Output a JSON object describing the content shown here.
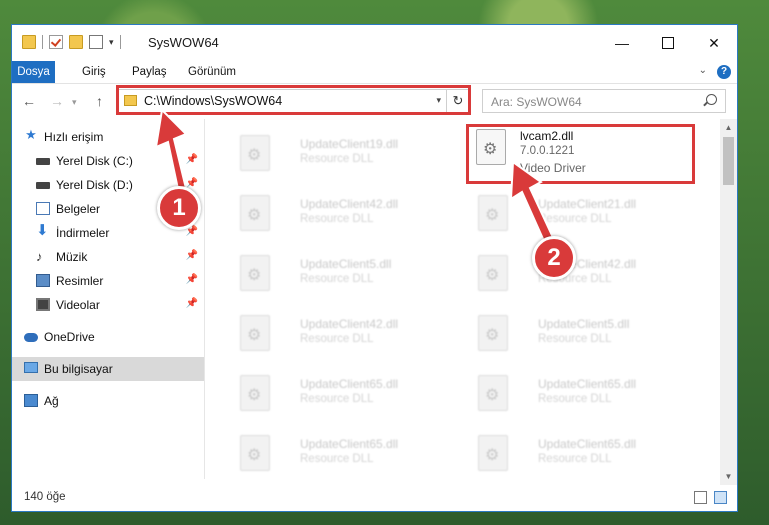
{
  "window": {
    "title": "SysWOW64",
    "controls": {
      "minimize": "—",
      "maximize": "",
      "close": "✕"
    }
  },
  "ribbon": {
    "tabs": [
      "Dosya",
      "Giriş",
      "Paylaş",
      "Görünüm"
    ],
    "help": "?"
  },
  "nav": {
    "back": "←",
    "forward": "→",
    "up": "↑",
    "address": "C:\\Windows\\SysWOW64",
    "refresh": "↻",
    "search_placeholder": "Ara: SysWOW64"
  },
  "sidebar": {
    "items": [
      {
        "label": "Hızlı erişim",
        "icon": "star-icon",
        "pinned": false
      },
      {
        "label": "Yerel Disk (C:)",
        "icon": "drive-icon",
        "pinned": true
      },
      {
        "label": "Yerel Disk (D:)",
        "icon": "drive-icon",
        "pinned": true
      },
      {
        "label": "Belgeler",
        "icon": "documents-icon",
        "pinned": true
      },
      {
        "label": "İndirmeler",
        "icon": "downloads-icon",
        "pinned": true
      },
      {
        "label": "Müzik",
        "icon": "music-icon",
        "pinned": true
      },
      {
        "label": "Resimler",
        "icon": "pictures-icon",
        "pinned": true
      },
      {
        "label": "Videolar",
        "icon": "videos-icon",
        "pinned": true
      },
      {
        "label": "OneDrive",
        "icon": "onedrive-icon",
        "pinned": false
      },
      {
        "label": "Bu bilgisayar",
        "icon": "computer-icon",
        "pinned": false,
        "selected": true
      },
      {
        "label": "Ağ",
        "icon": "network-icon",
        "pinned": false
      }
    ]
  },
  "files": {
    "left": [
      {
        "name": "UpdateClient19.dll",
        "type": "Resource DLL"
      },
      {
        "name": "UpdateClient42.dll",
        "type": "Resource DLL"
      },
      {
        "name": "UpdateClient5.dll",
        "type": "Resource DLL"
      },
      {
        "name": "UpdateClient42.dll",
        "type": "Resource DLL"
      },
      {
        "name": "UpdateClient65.dll",
        "type": "Resource DLL"
      },
      {
        "name": "UpdateClient65.dll",
        "type": "Resource DLL"
      }
    ],
    "right": [
      {
        "name": "lvcam2.dll",
        "type": "7.0.0.1221",
        "desc": "Video Driver",
        "highlighted": true
      },
      {
        "name": "UpdateClient21.dll",
        "type": "Resource DLL"
      },
      {
        "name": "UpdateClient42.dll",
        "type": "Resource DLL"
      },
      {
        "name": "UpdateClient5.dll",
        "type": "Resource DLL"
      },
      {
        "name": "UpdateClient65.dll",
        "type": "Resource DLL"
      },
      {
        "name": "UpdateClient65.dll",
        "type": "Resource DLL"
      }
    ]
  },
  "status": {
    "count": "140 öğe"
  },
  "annotations": {
    "step1": "1",
    "step2": "2",
    "color": "#d93a3a"
  }
}
